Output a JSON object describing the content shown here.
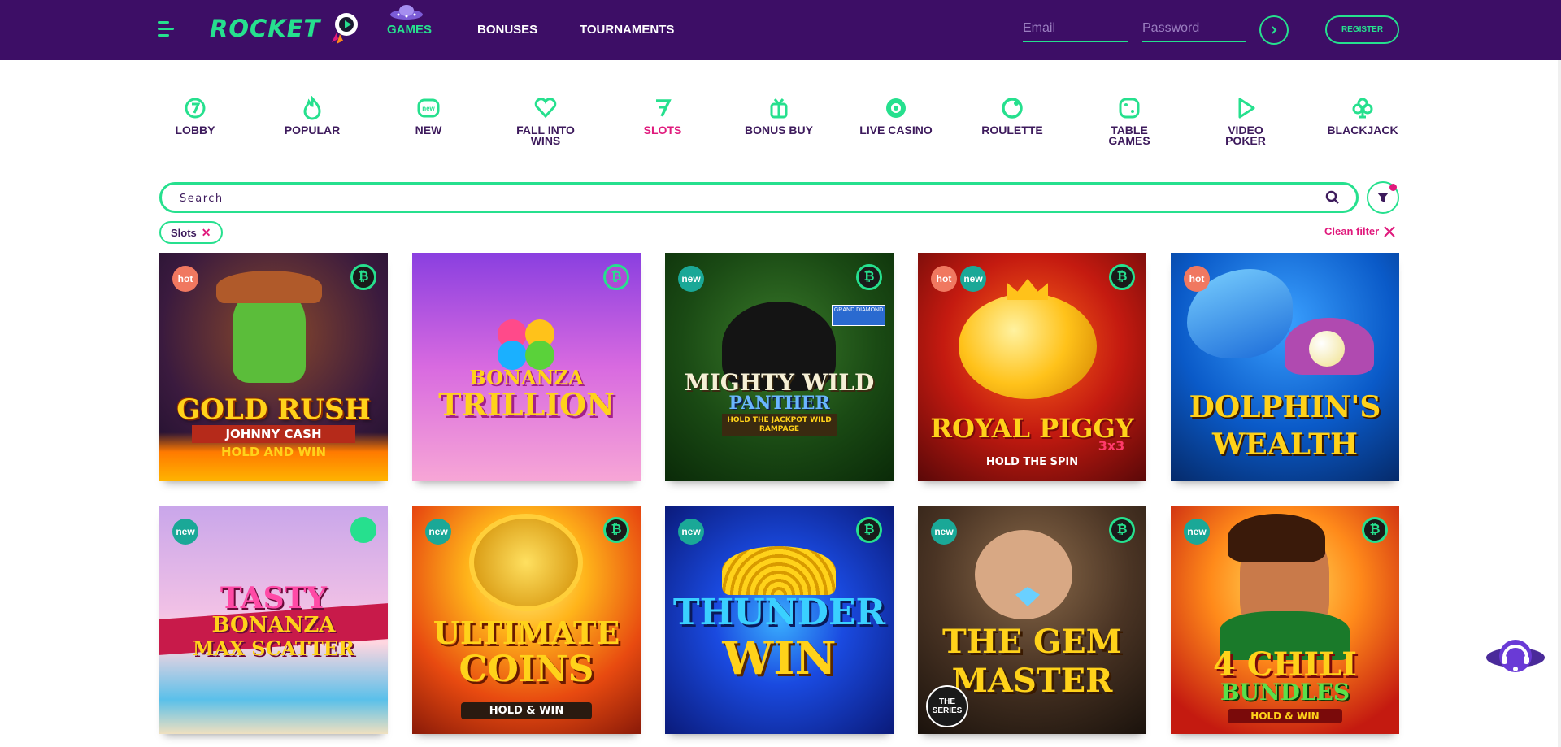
{
  "header": {
    "logo_text": "ROCKET",
    "nav": [
      {
        "label": "GAMES",
        "active": true
      },
      {
        "label": "BONUSES",
        "active": false
      },
      {
        "label": "TOURNAMENTS",
        "active": false
      }
    ],
    "email_placeholder": "Email",
    "password_placeholder": "Password",
    "register_label": "REGISTER"
  },
  "categories": [
    {
      "label": "LOBBY",
      "icon": "lobby-icon"
    },
    {
      "label": "POPULAR",
      "icon": "flame-icon"
    },
    {
      "label": "NEW",
      "icon": "new-badge-icon"
    },
    {
      "label": "FALL INTO WINS",
      "icon": "heart-icon"
    },
    {
      "label": "SLOTS",
      "icon": "slots-seven-icon",
      "active": true
    },
    {
      "label": "BONUS BUY",
      "icon": "gift-icon"
    },
    {
      "label": "LIVE CASINO",
      "icon": "chip-icon"
    },
    {
      "label": "ROULETTE",
      "icon": "roulette-icon"
    },
    {
      "label": "TABLE GAMES",
      "icon": "dice-icon"
    },
    {
      "label": "VIDEO POKER",
      "icon": "play-icon"
    },
    {
      "label": "BLACKJACK",
      "icon": "club-icon"
    }
  ],
  "search": {
    "placeholder": "Search"
  },
  "filters": {
    "chip_label": "Slots",
    "clean_label": "Clean filter"
  },
  "games": [
    {
      "title": "GOLD RUSH",
      "subtitle": "JOHNNY CASH",
      "tag": "HOLD AND WIN",
      "badges": [
        "hot"
      ],
      "btc": true
    },
    {
      "title": "BONANZA",
      "subtitle": "TRILLION",
      "tag": "",
      "badges": [],
      "btc": true
    },
    {
      "title": "MIGHTY WILD",
      "subtitle": "PANTHER",
      "tag": "HOLD THE JACKPOT WILD RAMPAGE",
      "badges": [
        "new"
      ],
      "btc": true
    },
    {
      "title": "ROYAL PIGGY",
      "subtitle": "3x3",
      "tag": "HOLD THE SPIN",
      "badges": [
        "hot",
        "new"
      ],
      "btc": true
    },
    {
      "title": "DOLPHIN'S",
      "subtitle": "WEALTH",
      "tag": "",
      "badges": [
        "hot"
      ],
      "btc": false
    },
    {
      "title": "TASTY",
      "subtitle": "BONANZA",
      "tag": "MAX SCATTER",
      "badges": [
        "new"
      ],
      "btc": true
    },
    {
      "title": "ULTIMATE",
      "subtitle": "COINS",
      "tag": "HOLD & WIN",
      "badges": [
        "new"
      ],
      "btc": true
    },
    {
      "title": "THUNDER",
      "subtitle": "WIN",
      "tag": "",
      "badges": [
        "new"
      ],
      "btc": true
    },
    {
      "title": "THE GEM",
      "subtitle": "MASTER",
      "tag": "THE SERIES",
      "badges": [
        "new"
      ],
      "btc": true
    },
    {
      "title": "4 CHILI",
      "subtitle": "BUNDLES",
      "tag": "HOLD & WIN",
      "badges": [
        "new"
      ],
      "btc": true
    }
  ],
  "colors": {
    "accent": "#26e08e",
    "brand": "#3d0e66",
    "highlight": "#e0197c"
  }
}
